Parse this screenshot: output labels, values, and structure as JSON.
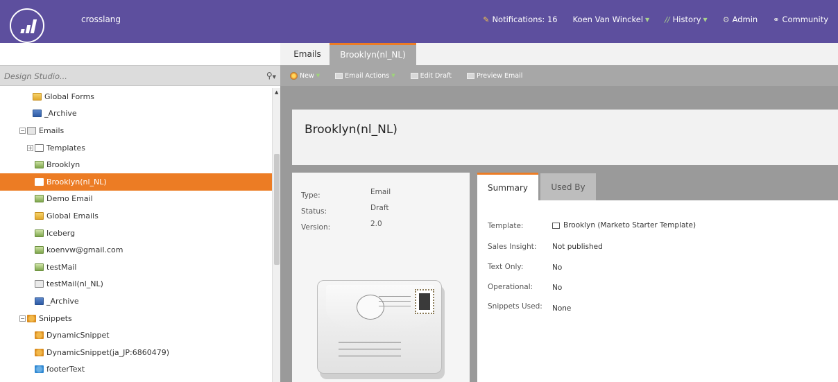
{
  "app": {
    "name": "crosslang"
  },
  "top_nav": {
    "notifications": "Notifications: 16",
    "user": "Koen Van Winckel",
    "history": "History",
    "admin": "Admin",
    "community": "Community"
  },
  "search": {
    "placeholder": "Design Studio..."
  },
  "tree": {
    "items": [
      {
        "label": "Global Forms"
      },
      {
        "label": "_Archive"
      },
      {
        "label": "Emails"
      },
      {
        "label": "Templates"
      },
      {
        "label": "Brooklyn"
      },
      {
        "label": "Brooklyn(nl_NL)"
      },
      {
        "label": "Demo Email"
      },
      {
        "label": "Global Emails"
      },
      {
        "label": "Iceberg"
      },
      {
        "label": "koenvw@gmail.com"
      },
      {
        "label": "testMail"
      },
      {
        "label": "testMail(nl_NL)"
      },
      {
        "label": "_Archive"
      },
      {
        "label": "Snippets"
      },
      {
        "label": "DynamicSnippet"
      },
      {
        "label": "DynamicSnippet(ja_JP:6860479)"
      },
      {
        "label": "footerText"
      }
    ]
  },
  "tabs": {
    "emails": "Emails",
    "active": "Brooklyn(nl_NL)"
  },
  "toolbar": {
    "new": "New",
    "email_actions": "Email Actions",
    "edit_draft": "Edit Draft",
    "preview_email": "Preview Email"
  },
  "page": {
    "title": "Brooklyn(nl_NL)"
  },
  "info": {
    "type_label": "Type:",
    "type_value": "Email",
    "status_label": "Status:",
    "status_value": "Draft",
    "version_label": "Version:",
    "version_value": "2.0"
  },
  "detail_tabs": {
    "summary": "Summary",
    "used_by": "Used By"
  },
  "summary": {
    "template_label": "Template:",
    "template_value": "Brooklyn (Marketo Starter Template)",
    "sales_insight_label": "Sales Insight:",
    "sales_insight_value": "Not published",
    "text_only_label": "Text Only:",
    "text_only_value": "No",
    "operational_label": "Operational:",
    "operational_value": "No",
    "snippets_label": "Snippets Used:",
    "snippets_value": "None"
  },
  "colors": {
    "header": "#5d4f9e",
    "accent": "#ec7c24",
    "toolbar": "#a7a7a7"
  }
}
